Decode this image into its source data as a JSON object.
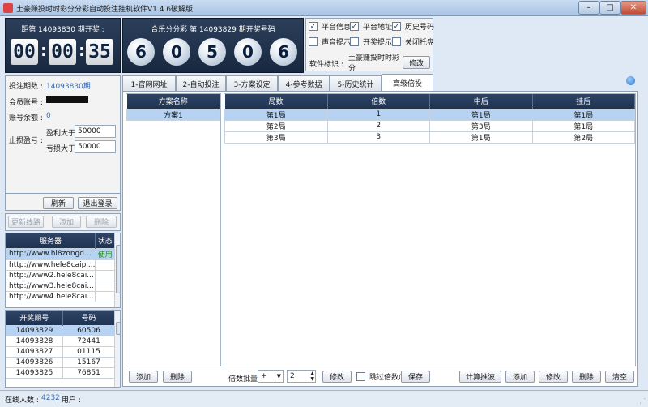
{
  "window": {
    "title": "土豪赚投时时彩分分彩自动投注挂机软件V1.4.6破解版",
    "min": "–",
    "max": "□",
    "close": "✕"
  },
  "countdown": {
    "header": "距第 14093830 期开奖 :",
    "digits": [
      "00",
      "00",
      "35"
    ],
    "sep": ":"
  },
  "lottery": {
    "header": "合乐分分彩 第 14093829 期开奖号码",
    "balls": [
      "6",
      "0",
      "5",
      "0",
      "6"
    ]
  },
  "options": {
    "row1": [
      {
        "label": "平台信息",
        "checked": true
      },
      {
        "label": "平台地址",
        "checked": true
      },
      {
        "label": "历史号码",
        "checked": true
      }
    ],
    "row2": [
      {
        "label": "声音提示",
        "checked": false
      },
      {
        "label": "开奖提示",
        "checked": false
      },
      {
        "label": "关闭托盘",
        "checked": false
      }
    ],
    "software_id_label": "软件标识 :",
    "software_id_value": "土豪赚投时时彩分",
    "modify": "修改",
    "check_mark": "✓"
  },
  "tabs": [
    "1-官网网址",
    "2-自动投注",
    "3-方案设定",
    "4-参考数据",
    "5-历史统计",
    "高级倍投"
  ],
  "account": {
    "bet_period_label": "投注期数 :",
    "bet_period_value": "14093830期",
    "member_label": "会员账号 :",
    "balance_label": "账号余额 :",
    "balance_value": "0",
    "stop_label": "止损盈亏 :",
    "profit_label": "盈利大于",
    "profit_value": "50000",
    "loss_label": "亏损大于",
    "loss_value": "50000",
    "refresh": "刷新",
    "logout": "退出登录"
  },
  "server_buttons": [
    "更新线路",
    "添加",
    "删除"
  ],
  "servers": {
    "headers": [
      "服务器",
      "状态"
    ],
    "rows": [
      [
        "http://www.hl8zongd...",
        "使用"
      ],
      [
        "http://www.hele8caipi...",
        ""
      ],
      [
        "http://www2.hele8cai...",
        ""
      ],
      [
        "http://www3.hele8cai...",
        ""
      ],
      [
        "http://www4.hele8cai...",
        ""
      ]
    ]
  },
  "history": {
    "headers": [
      "开奖期号",
      "号码"
    ],
    "rows": [
      [
        "14093829",
        "60506"
      ],
      [
        "14093828",
        "72441"
      ],
      [
        "14093827",
        "01115"
      ],
      [
        "14093826",
        "15167"
      ],
      [
        "14093825",
        "76851"
      ]
    ]
  },
  "plans": {
    "header": "方案名称",
    "rows": [
      "方案1"
    ],
    "add": "添加",
    "delete": "删除"
  },
  "rounds": {
    "headers": [
      "局数",
      "倍数",
      "中后",
      "挂后"
    ],
    "rows": [
      [
        "第1局",
        "1",
        "第1局",
        "第1局"
      ],
      [
        "第2局",
        "2",
        "第3局",
        "第1局"
      ],
      [
        "第3局",
        "3",
        "第1局",
        "第2局"
      ]
    ]
  },
  "bottom": {
    "batch_label": "倍数批量",
    "op_value": "+",
    "num_value": "2",
    "modify": "修改",
    "skip_label": "跳过倍数0",
    "save": "保存",
    "calc": "计算推波",
    "add": "添加",
    "edit": "修改",
    "delete": "删除",
    "clear": "清空"
  },
  "status": {
    "online_label": "在线人数 :",
    "online_value": "4232",
    "user_label": "用户 :"
  }
}
